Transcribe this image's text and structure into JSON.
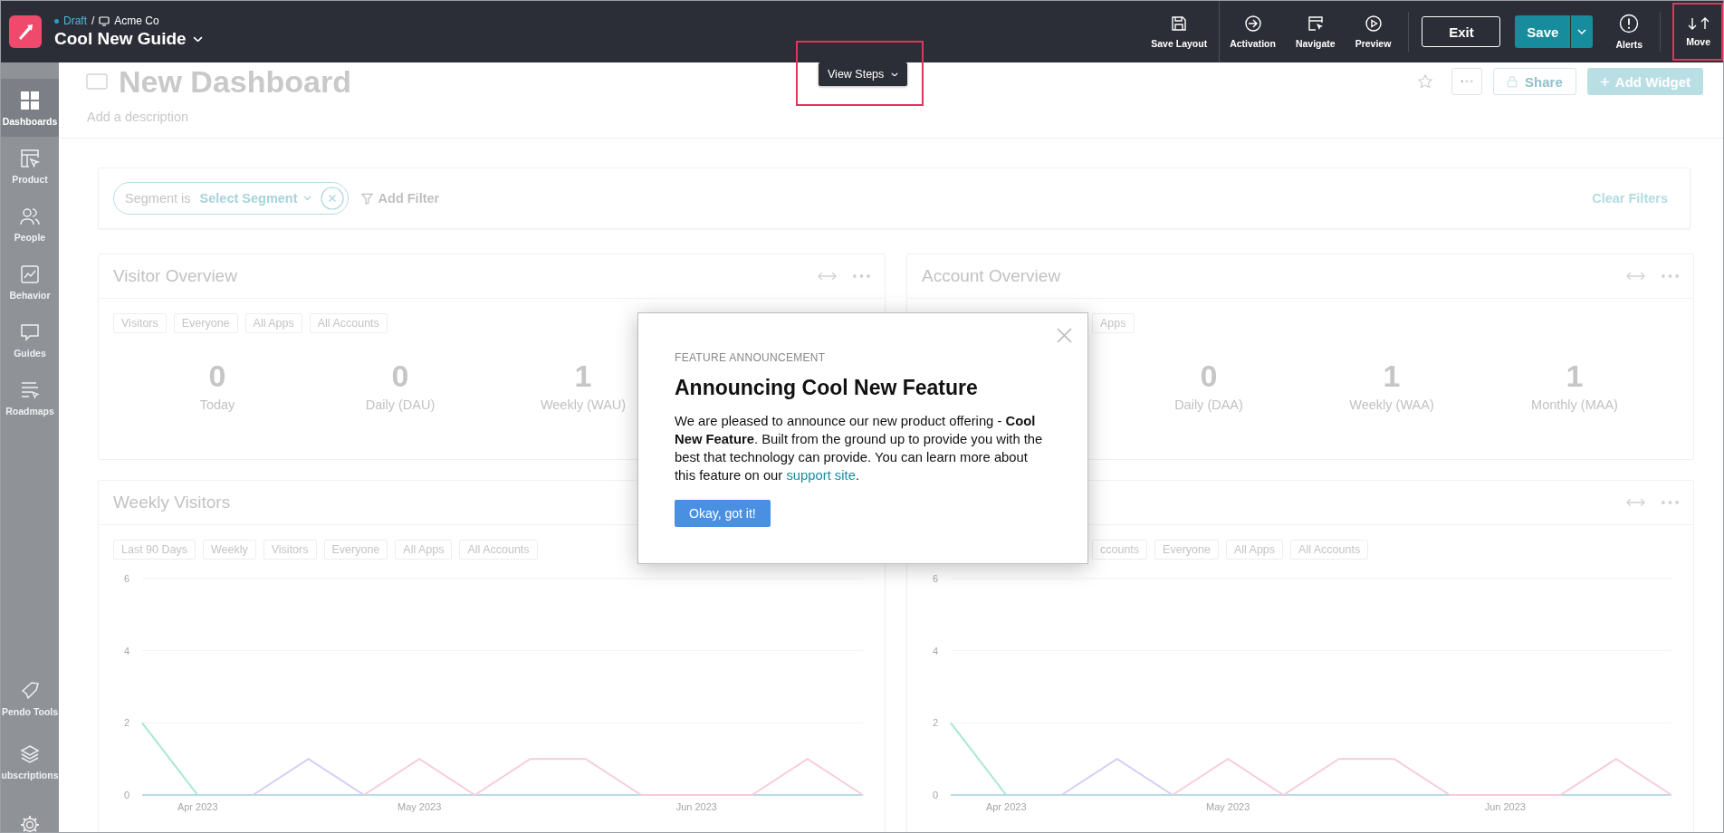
{
  "top_bar": {
    "status": "Draft",
    "separator": "/",
    "app": "Acme Co",
    "guide_title": "Cool New Guide",
    "tools": [
      {
        "kind": "save-layout",
        "label": "Save Layout"
      },
      {
        "kind": "activation",
        "label": "Activation"
      },
      {
        "kind": "navigate",
        "label": "Navigate"
      },
      {
        "kind": "preview",
        "label": "Preview"
      }
    ],
    "exit": "Exit",
    "save": "Save",
    "alerts": "Alerts",
    "move": "Move"
  },
  "view_steps": "View Steps",
  "sidebar": {
    "items": [
      {
        "kind": "dashboards",
        "label": "Dashboards",
        "selected": true
      },
      {
        "kind": "product",
        "label": "Product",
        "selected": false
      },
      {
        "kind": "people",
        "label": "People",
        "selected": false
      },
      {
        "kind": "behavior",
        "label": "Behavior",
        "selected": false
      },
      {
        "kind": "guides",
        "label": "Guides",
        "selected": false
      },
      {
        "kind": "roadmaps",
        "label": "Roadmaps",
        "selected": false
      }
    ],
    "bottom_items": [
      {
        "kind": "tools",
        "label": "Pendo Tools",
        "selected": false
      },
      {
        "kind": "subscriptions",
        "label": "ubscriptions",
        "selected": false
      },
      {
        "kind": "settings",
        "selected": false
      }
    ]
  },
  "dashboard": {
    "title": "New Dashboard",
    "description": "Add a description",
    "share": "Share",
    "add_widget": "Add Widget"
  },
  "filters": {
    "segment_label": "Segment is",
    "segment_value": "Select Segment",
    "add_filter": "Add Filter",
    "clear": "Clear Filters"
  },
  "overview_widgets": [
    {
      "title": "Visitor Overview",
      "chips": [
        "Visitors",
        "Everyone",
        "All Apps",
        "All Accounts"
      ],
      "covered": false,
      "metrics": [
        {
          "value": "0",
          "label": "Today"
        },
        {
          "value": "0",
          "label": "Daily (DAU)"
        },
        {
          "value": "1",
          "label": "Weekly (WAU)"
        }
      ]
    },
    {
      "title": "Account Overview",
      "chips": [
        "Apps"
      ],
      "covered": true,
      "metrics": [
        {
          "value": "0",
          "label": "Daily (DAA)"
        },
        {
          "value": "1",
          "label": "Weekly (WAA)"
        },
        {
          "value": "1",
          "label": "Monthly (MAA)"
        }
      ]
    }
  ],
  "chart_widgets": [
    {
      "title": "Weekly Visitors",
      "chips": [
        "Last 90 Days",
        "Weekly",
        "Visitors",
        "Everyone",
        "All Apps",
        "All Accounts"
      ],
      "covered": false,
      "chart_data": {
        "type": "line",
        "categories": [
          null,
          "Apr 2023",
          null,
          null,
          null,
          "May 2023",
          null,
          null,
          null,
          null,
          "Jun 2023",
          null,
          null,
          null
        ],
        "ylim": [
          0,
          6
        ],
        "yticks": [
          0,
          2,
          4,
          6
        ],
        "series": [
          {
            "color": "#b9dbe8",
            "values": [
              0,
              0,
              0,
              0,
              0,
              0,
              0,
              0,
              0,
              0,
              0,
              0,
              0,
              0
            ]
          },
          {
            "color": "#a8e6d4",
            "values": [
              2,
              0,
              null,
              null,
              null,
              null,
              null,
              null,
              null,
              null,
              null,
              null,
              null,
              null
            ]
          },
          {
            "color": "#d6cdf6",
            "values": [
              null,
              null,
              0,
              1,
              0,
              null,
              null,
              null,
              null,
              null,
              null,
              null,
              null,
              null
            ]
          },
          {
            "color": "#f6cdd9",
            "values": [
              null,
              null,
              null,
              null,
              0,
              1,
              0,
              1,
              1,
              0,
              0,
              0,
              1,
              0
            ]
          }
        ]
      }
    },
    {
      "chips": [
        "ccounts",
        "Everyone",
        "All Apps",
        "All Accounts"
      ],
      "covered": true,
      "chart_data": {
        "type": "line",
        "categories": [
          null,
          "Apr 2023",
          null,
          null,
          null,
          "May 2023",
          null,
          null,
          null,
          null,
          "Jun 2023",
          null,
          null,
          null
        ],
        "ylim": [
          0,
          6
        ],
        "yticks": [
          0,
          2,
          4,
          6
        ],
        "series": [
          {
            "color": "#b9dbe8",
            "values": [
              0,
              0,
              0,
              0,
              0,
              0,
              0,
              0,
              0,
              0,
              0,
              0,
              0,
              0
            ]
          },
          {
            "color": "#a8e6d4",
            "values": [
              2,
              0,
              null,
              null,
              null,
              null,
              null,
              null,
              null,
              null,
              null,
              null,
              null,
              null
            ]
          },
          {
            "color": "#d6cdf6",
            "values": [
              null,
              null,
              0,
              1,
              0,
              null,
              null,
              null,
              null,
              null,
              null,
              null,
              null,
              null
            ]
          },
          {
            "color": "#f6cdd9",
            "values": [
              null,
              null,
              null,
              null,
              0,
              1,
              0,
              1,
              1,
              0,
              0,
              0,
              1,
              0
            ]
          }
        ]
      }
    }
  ],
  "dialog": {
    "eyebrow": "FEATURE ANNOUNCEMENT",
    "title": "Announcing Cool New Feature",
    "body": "We are pleased to announce our new product offering - **Cool New Feature**. Built from the ground up to provide you with the best that technology can provide. You can learn more about this feature on our ",
    "link": "support site",
    "body_end": ".",
    "button": "Okay, got it!"
  }
}
